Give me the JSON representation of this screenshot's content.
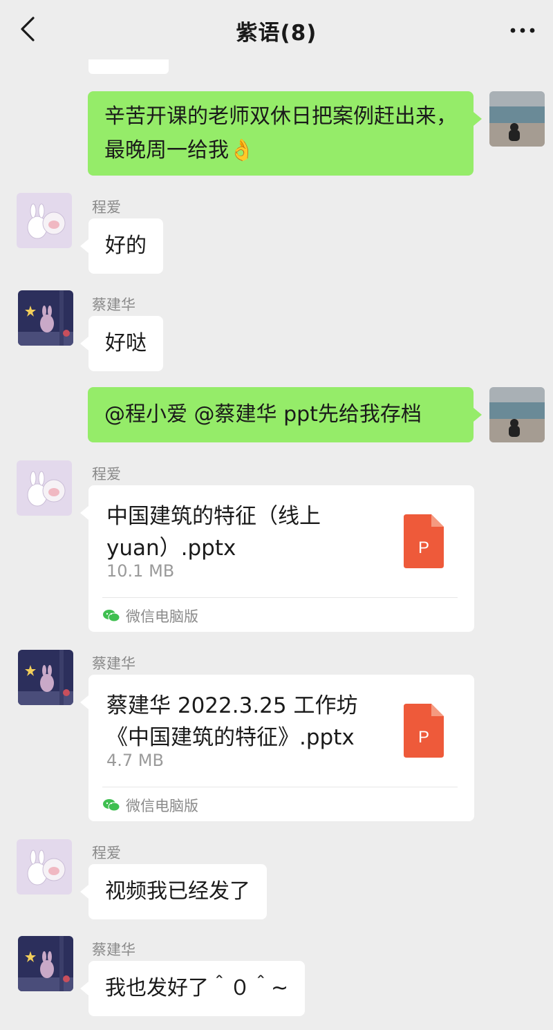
{
  "header": {
    "title": "紫语(8)"
  },
  "messages": {
    "m1": {
      "text": "辛苦开课的老师双休日把案例赶出来，最晚周一给我👌"
    },
    "m2": {
      "sender": "程爱",
      "text": "好的"
    },
    "m3": {
      "sender": "蔡建华",
      "text": "好哒"
    },
    "m4": {
      "text": "@程小爱 @蔡建华 ppt先给我存档"
    },
    "m5": {
      "sender": "程爱",
      "file_name": "中国建筑的特征（线上yuan）.pptx",
      "file_size": "10.1 MB",
      "file_type": "P",
      "source": "微信电脑版"
    },
    "m6": {
      "sender": "蔡建华",
      "file_name": "蔡建华 2022.3.25 工作坊《中国建筑的特征》.pptx",
      "file_size": "4.7 MB",
      "file_type": "P",
      "source": "微信电脑版"
    },
    "m7": {
      "sender": "程爱",
      "text": "视频我已经发了"
    },
    "m8": {
      "sender": "蔡建华",
      "text": "我也发好了＾０＾~"
    }
  },
  "colors": {
    "background": "#ededed",
    "self_bubble": "#95ec69",
    "other_bubble": "#ffffff",
    "ppt_icon": "#ee5a3a"
  }
}
